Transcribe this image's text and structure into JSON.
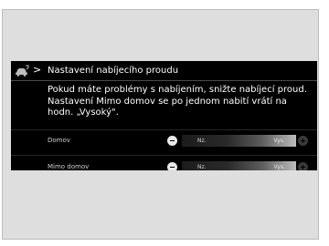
{
  "header": {
    "title": "Nastavení nabíjecího proudu"
  },
  "description": "Pokud máte problémy s nabíjením, snižte nabíjecí proud. Nastavení Mimo domov se po jednom nabití vrátí na hodn. „Vysoký\".",
  "rows": [
    {
      "label": "Domov",
      "low_label": "Nz.",
      "high_label": "Vys."
    },
    {
      "label": "Mimo domov",
      "low_label": "Nz.",
      "high_label": "Vys."
    }
  ],
  "icons": {
    "car": "car-charge-icon",
    "chevron": "chevron-right-icon",
    "minus": "minus-icon",
    "plus": "plus-icon"
  }
}
